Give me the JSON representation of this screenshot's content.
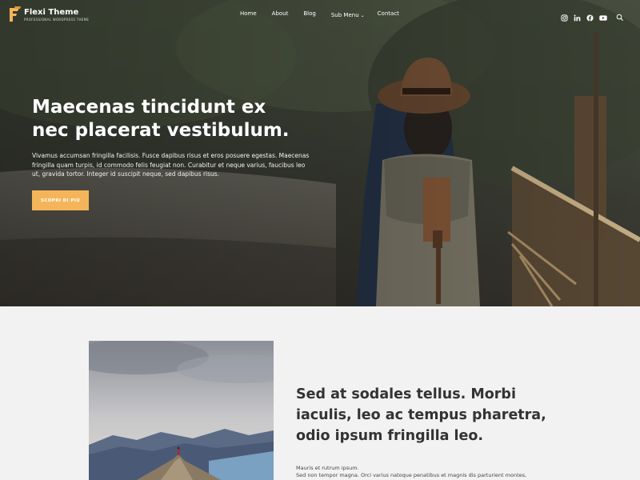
{
  "brand": {
    "name": "Flexi Theme",
    "tagline": "PROFESSIONAL WORDPRESS THEME"
  },
  "nav": {
    "items": [
      "Home",
      "About",
      "Blog",
      "Sub Menu",
      "Contact"
    ]
  },
  "social": {
    "icons": [
      "instagram-icon",
      "linkedin-icon",
      "facebook-icon",
      "youtube-icon"
    ]
  },
  "hero": {
    "title": "Maecenas tincidunt ex nec placerat vestibulum.",
    "text": "Vivamus accumsan fringilla facilisis. Fusce dapibus risus et eros posuere egestas. Maecenas fringilla quam turpis, id commodo felis feugiat non. Curabitur et neque varius, faucibus leo ut, gravida tortor. Integer id suscipit neque, sed dapibus risus.",
    "cta_label": "SCOPRI DI PIÙ"
  },
  "feature": {
    "headline": "Sed at sodales tellus. Morbi iaculis, leo ac tempus pharetra, odio ipsum fringilla leo.",
    "body_line1": "Mauris et rutrum ipsum.",
    "body_line2": "Sed non tempor magna. Orci varius natoque penatibus et magnis dis parturient montes,"
  },
  "colors": {
    "accent": "#f4b55a",
    "background": "#f2f2f2",
    "heading": "#333333"
  }
}
